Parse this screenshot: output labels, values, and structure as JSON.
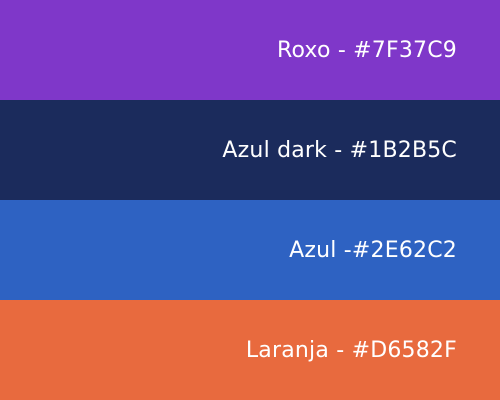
{
  "swatches": [
    {
      "label": "Roxo - #7F37C9",
      "color": "#7F37C9"
    },
    {
      "label": "Azul dark - #1B2B5C",
      "color": "#1B2B5C"
    },
    {
      "label": "Azul -#2E62C2",
      "color": "#2E62C2"
    },
    {
      "label": "Laranja - #D6582F",
      "color": "#E86A3E"
    }
  ]
}
